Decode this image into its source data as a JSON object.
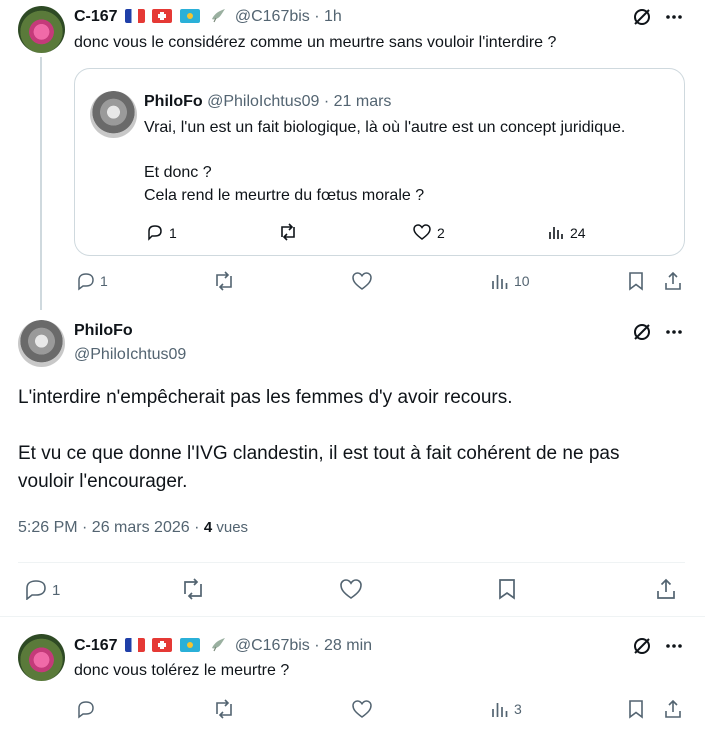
{
  "tweet1": {
    "name": "C-167",
    "flags": [
      "fr",
      "ch",
      "kz"
    ],
    "handle_time": "@C167bis · 1h",
    "text": "donc vous le considérez comme un meurtre sans vouloir l'interdire ?",
    "stats": {
      "replies": "1",
      "views": "10"
    }
  },
  "quoted": {
    "name": "PhiloFo",
    "handle_time": "@PhiloIchtus09 · 21 mars",
    "line1": "Vrai, l'un est un fait biologique, là où l'autre est un concept juridique.",
    "line2": "Et donc ?",
    "line3": "Cela rend le meurtre du fœtus morale ?",
    "stats": {
      "replies": "1",
      "likes": "2",
      "views": "24"
    }
  },
  "main": {
    "name": "PhiloFo",
    "handle": "@PhiloIchtus09",
    "para1": "L'interdire n'empêcherait pas les femmes d'y avoir recours.",
    "para2_line1": "Et vu ce que donne l'IVG clandestin, il est tout à fait cohérent de ne pas",
    "para2_line2": "vouloir l'encourager.",
    "timestamp": "5:26 PM · 26 mars 2026 · ",
    "views_count": "4",
    "views_label": " vues",
    "stats": {
      "replies": "1"
    }
  },
  "reply": {
    "name": "C-167",
    "handle_time": "@C167bis · 28 min",
    "text": "donc vous tolérez le meurtre ?",
    "stats": {
      "views": "3"
    }
  },
  "colors": {
    "text": "#0f1419",
    "muted": "#536471",
    "border": "#cfd9de"
  }
}
